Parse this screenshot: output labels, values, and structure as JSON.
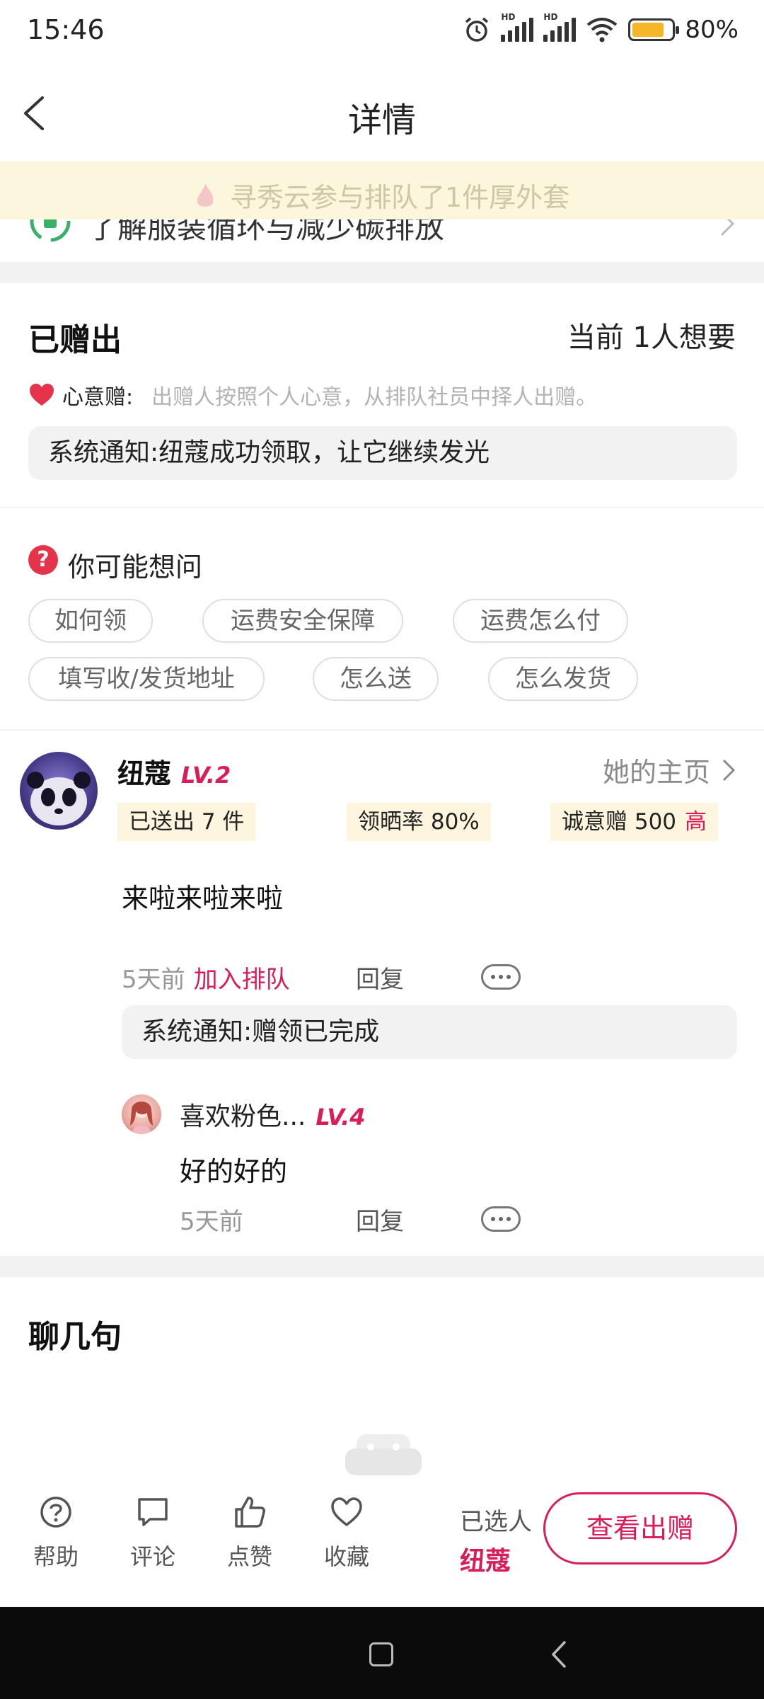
{
  "status_bar": {
    "time": "15:46",
    "battery": "80%",
    "icons": [
      "alarm-icon",
      "hd-signal-icon",
      "hd-signal-icon",
      "wifi-icon",
      "battery-icon"
    ]
  },
  "header": {
    "title": "详情",
    "back_icon": "chevron-left-icon"
  },
  "ticker": {
    "text": "寻秀云参与排队了1件厚外套"
  },
  "eco_banner": {
    "text": "了解服装循环与减少碳排放"
  },
  "given_section": {
    "title": "已赠出",
    "want_count": "当前 1人想要",
    "mode_label": "心意赠:",
    "mode_desc": "出赠人按照个人心意，从排队社员中择人出赠。",
    "notice": "系统通知:纽蔻成功领取，让它继续发光"
  },
  "faq": {
    "title": "你可能想问",
    "chips": [
      "如何领",
      "运费安全保障",
      "运费怎么付",
      "填写收/发货地址",
      "怎么送",
      "怎么发货"
    ]
  },
  "recipient": {
    "name": "纽蔻",
    "level": "LV.2",
    "home_link": "她的主页",
    "stats": {
      "sent": "已送出 7 件",
      "sun_rate": "领晒率 80%",
      "sincerity_label": "诚意赠 500",
      "sincerity_level": "高"
    },
    "comment": "来啦来啦来啦",
    "time": "5天前",
    "action": "加入排队",
    "reply_label": "回复",
    "system_notice": "系统通知:赠领已完成",
    "reply": {
      "name": "喜欢粉色...",
      "level": "LV.4",
      "text": "好的好的",
      "time": "5天前",
      "reply_label": "回复"
    }
  },
  "chat_section": {
    "title": "聊几句"
  },
  "bottom_bar": {
    "tabs": [
      {
        "label": "帮助",
        "icon": "help-icon"
      },
      {
        "label": "评论",
        "icon": "comment-icon"
      },
      {
        "label": "点赞",
        "icon": "thumbs-up-icon"
      },
      {
        "label": "收藏",
        "icon": "heart-icon"
      }
    ],
    "selected_label": "已选人",
    "selected_name": "纽蔻",
    "cta": "查看出赠"
  },
  "colors": {
    "accent": "#d91d5b",
    "ticker_bg": "#fbf6dc",
    "stat_bg": "#fdf5de",
    "heart": "#e5334b"
  }
}
